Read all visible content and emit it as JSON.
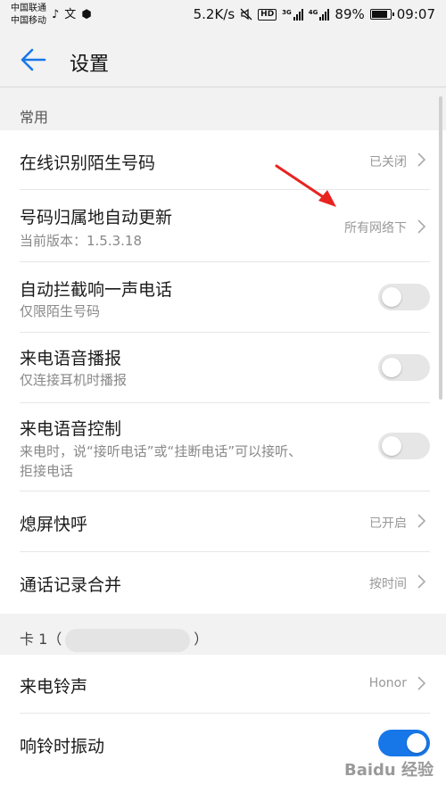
{
  "status_bar": {
    "carrier_1": "中国联通",
    "carrier_2": "中国移动",
    "speed": "5.2K/s",
    "hd": "HD",
    "net_1": "3G",
    "net_2": "4G",
    "battery": "89%",
    "time": "09:07"
  },
  "header": {
    "title": "设置"
  },
  "common_section": {
    "label": "常用",
    "rows": [
      {
        "title": "在线识别陌生号码",
        "value": "已关闭"
      },
      {
        "title": "号码归属地自动更新",
        "subtitle": "当前版本：1.5.3.18",
        "value": "所有网络下"
      },
      {
        "title": "自动拦截响一声电话",
        "subtitle": "仅限陌生号码",
        "toggle_on": false
      },
      {
        "title": "来电语音播报",
        "subtitle": "仅连接耳机时播报",
        "toggle_on": false
      },
      {
        "title": "来电语音控制",
        "subtitle_line1": "来电时，说“接听电话”或“挂断电话”可以接听、",
        "subtitle_line2": "拒接电话",
        "toggle_on": false
      },
      {
        "title": "熄屏快呼",
        "value": "已开启"
      },
      {
        "title": "通话记录合并",
        "value": "按时间"
      }
    ]
  },
  "card1_section": {
    "label_prefix": "卡 1（",
    "label_suffix": "）",
    "rows": [
      {
        "title": "来电铃声",
        "value": "Honor"
      },
      {
        "title": "响铃时振动",
        "toggle_on": true
      }
    ]
  },
  "colors": {
    "accent": "#1777e8",
    "annotation_arrow": "#e8231f"
  },
  "watermark": "Baidu 经验"
}
